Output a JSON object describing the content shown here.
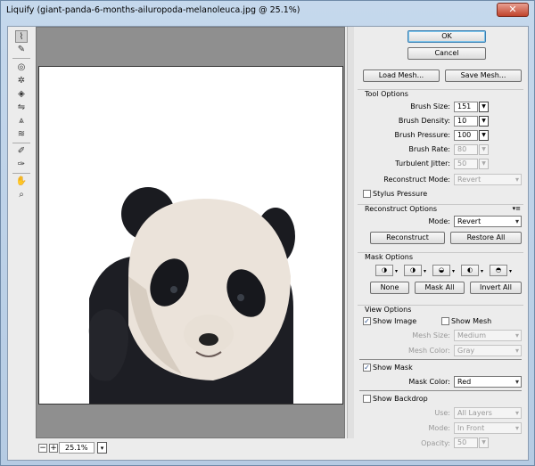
{
  "window": {
    "title": "Liquify (giant-panda-6-months-ailuropoda-melanoleuca.jpg @ 25.1%)",
    "close_glyph": "✕"
  },
  "tools": [
    "forward-warp-icon",
    "reconstruct-icon",
    "twirl-clockwise-icon",
    "pucker-icon",
    "bloat-icon",
    "push-left-icon",
    "mirror-icon",
    "turbulence-icon",
    "freeze-mask-icon",
    "thaw-mask-icon",
    "hand-icon",
    "zoom-icon"
  ],
  "zoom": {
    "minus": "−",
    "plus": "+",
    "value": "25.1%",
    "dropdown": "▾"
  },
  "buttons": {
    "ok": "OK",
    "cancel": "Cancel",
    "load_mesh": "Load Mesh...",
    "save_mesh": "Save Mesh..."
  },
  "tool_options": {
    "title": "Tool Options",
    "brush_size": {
      "label": "Brush Size:",
      "value": "151"
    },
    "brush_density": {
      "label": "Brush Density:",
      "value": "10"
    },
    "brush_pressure": {
      "label": "Brush Pressure:",
      "value": "100"
    },
    "brush_rate": {
      "label": "Brush Rate:",
      "value": "80"
    },
    "turbulent_jitter": {
      "label": "Turbulent Jitter:",
      "value": "50"
    },
    "reconstruct_mode": {
      "label": "Reconstruct Mode:",
      "value": "Revert"
    },
    "stylus_pressure": {
      "label": "Stylus Pressure",
      "checked": false
    }
  },
  "reconstruct_options": {
    "title": "Reconstruct Options",
    "menu_glyph": "▾≡",
    "mode_label": "Mode:",
    "mode_value": "Revert",
    "reconstruct": "Reconstruct",
    "restore_all": "Restore All"
  },
  "mask_options": {
    "title": "Mask Options",
    "none": "None",
    "mask_all": "Mask All",
    "invert_all": "Invert All"
  },
  "view_options": {
    "title": "View Options",
    "show_image": {
      "label": "Show Image",
      "checked": true
    },
    "show_mesh": {
      "label": "Show Mesh",
      "checked": false
    },
    "mesh_size": {
      "label": "Mesh Size:",
      "value": "Medium"
    },
    "mesh_color": {
      "label": "Mesh Color:",
      "value": "Gray"
    },
    "show_mask": {
      "label": "Show Mask",
      "checked": true
    },
    "mask_color": {
      "label": "Mask Color:",
      "value": "Red"
    },
    "show_backdrop": {
      "label": "Show Backdrop",
      "checked": false
    },
    "use": {
      "label": "Use:",
      "value": "All Layers"
    },
    "mode": {
      "label": "Mode:",
      "value": "In Front"
    },
    "opacity": {
      "label": "Opacity:",
      "value": "50"
    }
  },
  "colors": {
    "panda_white": "#ebe3da",
    "panda_black": "#1c1d22"
  }
}
